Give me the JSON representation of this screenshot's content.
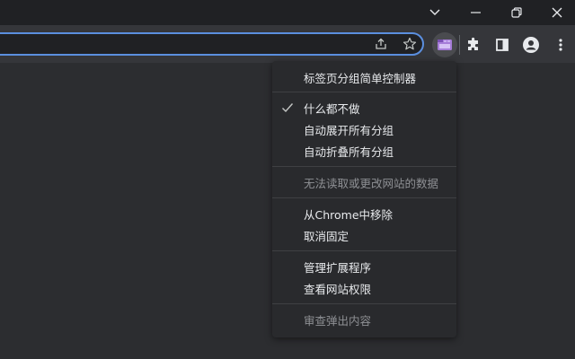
{
  "window_controls": {
    "tab_search": "tab-search-chevron",
    "minimize": "minimize",
    "restore": "restore",
    "close": "close"
  },
  "toolbar": {
    "share_icon": "share-icon",
    "bookmark_icon": "star-icon",
    "extension_active_icon": "tab-groups-extension-icon",
    "extensions_icon": "puzzle-icon",
    "sidepanel_icon": "side-panel-icon",
    "profile_icon": "profile-icon",
    "menu_icon": "kebab-menu-icon"
  },
  "menu": {
    "title": "标签页分组简单控制器",
    "options": [
      {
        "label": "什么都不做",
        "checked": true
      },
      {
        "label": "自动展开所有分组",
        "checked": false
      },
      {
        "label": "自动折叠所有分组",
        "checked": false
      }
    ],
    "site_access": "无法读取或更改网站的数据",
    "remove": "从Chrome中移除",
    "unpin": "取消固定",
    "manage": "管理扩展程序",
    "permissions": "查看网站权限",
    "inspect": "审查弹出内容"
  }
}
